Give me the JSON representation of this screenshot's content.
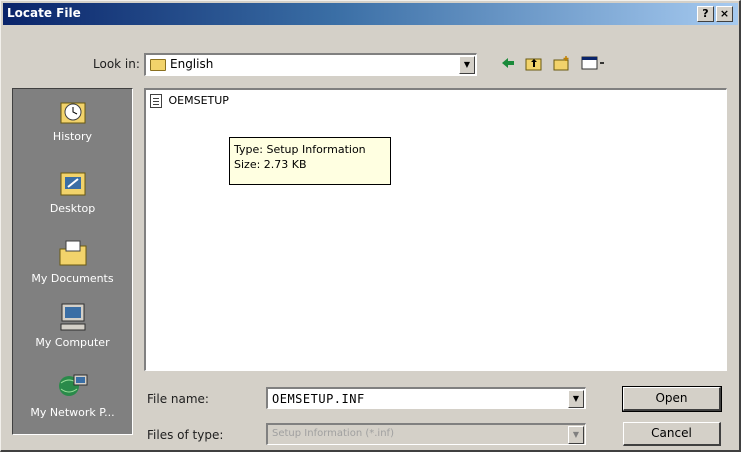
{
  "window": {
    "title": "Locate File",
    "help_label": "?",
    "close_label": "×"
  },
  "lookin": {
    "label": "Look in:",
    "value": "English"
  },
  "toolbar": {
    "back_icon": "back-arrow-icon",
    "up_icon": "up-folder-icon",
    "newfolder_icon": "new-folder-icon",
    "views_icon": "views-menu-icon"
  },
  "places": [
    {
      "label": "History",
      "icon": "history-icon"
    },
    {
      "label": "Desktop",
      "icon": "desktop-icon"
    },
    {
      "label": "My Documents",
      "icon": "my-documents-icon"
    },
    {
      "label": "My Computer",
      "icon": "my-computer-icon"
    },
    {
      "label": "My Network P...",
      "icon": "my-network-places-icon"
    }
  ],
  "files": [
    {
      "name": "OEMSETUP"
    }
  ],
  "tooltip": {
    "line1": "Type: Setup Information",
    "line2": "Size: 2.73 KB"
  },
  "filename": {
    "label": "File name:",
    "value": "OEMSETUP.INF"
  },
  "filetype": {
    "label": "Files of type:",
    "value": "Setup Information (*.inf)"
  },
  "buttons": {
    "open": "Open",
    "cancel": "Cancel"
  }
}
